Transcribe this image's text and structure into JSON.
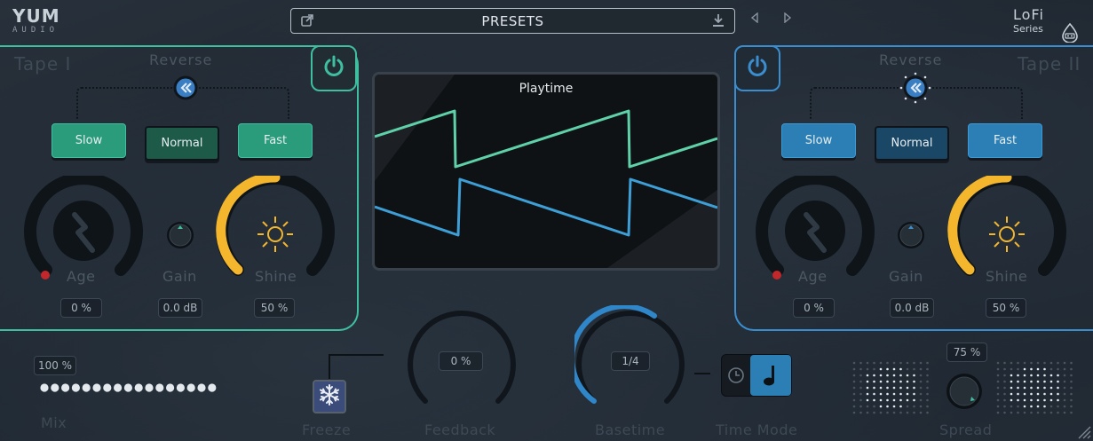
{
  "header": {
    "logo_main": "YUM",
    "logo_sub": "AUDIO",
    "presets_label": "PRESETS",
    "series_main": "LoFi",
    "series_sub": "Series"
  },
  "tape_left": {
    "title": "Tape I",
    "reverse_label": "Reverse",
    "buttons": {
      "slow": "Slow",
      "normal": "Normal",
      "fast": "Fast"
    },
    "selected_speed": "Normal",
    "age_label": "Age",
    "age_value": "0 %",
    "age_level": 0,
    "gain_label": "Gain",
    "gain_value": "0.0 dB",
    "shine_label": "Shine",
    "shine_value": "50 %",
    "shine_level": 0.5,
    "accent": "#3fbfa0"
  },
  "tape_right": {
    "title": "Tape II",
    "reverse_label": "Reverse",
    "buttons": {
      "slow": "Slow",
      "normal": "Normal",
      "fast": "Fast"
    },
    "selected_speed": "Normal",
    "age_label": "Age",
    "age_value": "0 %",
    "age_level": 0,
    "gain_label": "Gain",
    "gain_value": "0.0 dB",
    "shine_label": "Shine",
    "shine_value": "50 %",
    "shine_level": 0.5,
    "accent": "#3a8ecf"
  },
  "display": {
    "title": "Playtime",
    "line_colors": [
      "#5fd1a8",
      "#3d9fd6"
    ]
  },
  "bottom": {
    "mix_label": "Mix",
    "mix_value": "100 %",
    "mix_level": 1.0,
    "freeze_label": "Freeze",
    "feedback_label": "Feedback",
    "feedback_value": "0 %",
    "feedback_level": 0,
    "basetime_label": "Basetime",
    "basetime_value": "1/4",
    "timemode_label": "Time Mode",
    "timemode_selected": "note",
    "spread_label": "Spread",
    "spread_value": "75 %",
    "spread_level": 0.75
  },
  "colors": {
    "green": "#3fbfa0",
    "blue": "#3a8ecf",
    "amber": "#f3b62d"
  }
}
